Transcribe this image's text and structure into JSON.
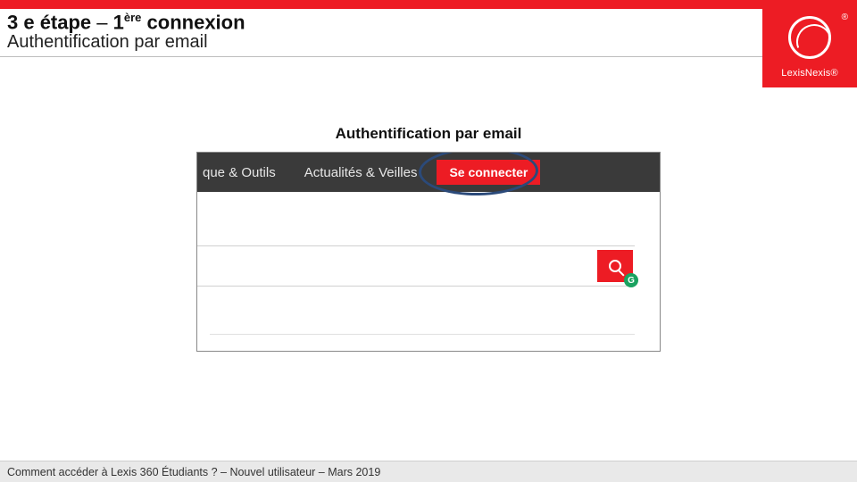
{
  "header": {
    "title_part1": "3 e étape",
    "title_dash": " – ",
    "title_part2_pre": "1",
    "title_part2_sup": "ère",
    "title_part2_post": " connexion",
    "subtitle": "Authentification par email"
  },
  "logo": {
    "brand": "LexisNexis",
    "reg": "®"
  },
  "section": {
    "title": "Authentification par email"
  },
  "nav": {
    "item_left_truncated": "que & Outils",
    "item_mid": "Actualités & Veilles",
    "connect_button": "Se connecter"
  },
  "badge": {
    "letter": "G"
  },
  "footer": {
    "text": "Comment accéder à Lexis 360 Étudiants ? – Nouvel utilisateur – Mars 2019"
  }
}
